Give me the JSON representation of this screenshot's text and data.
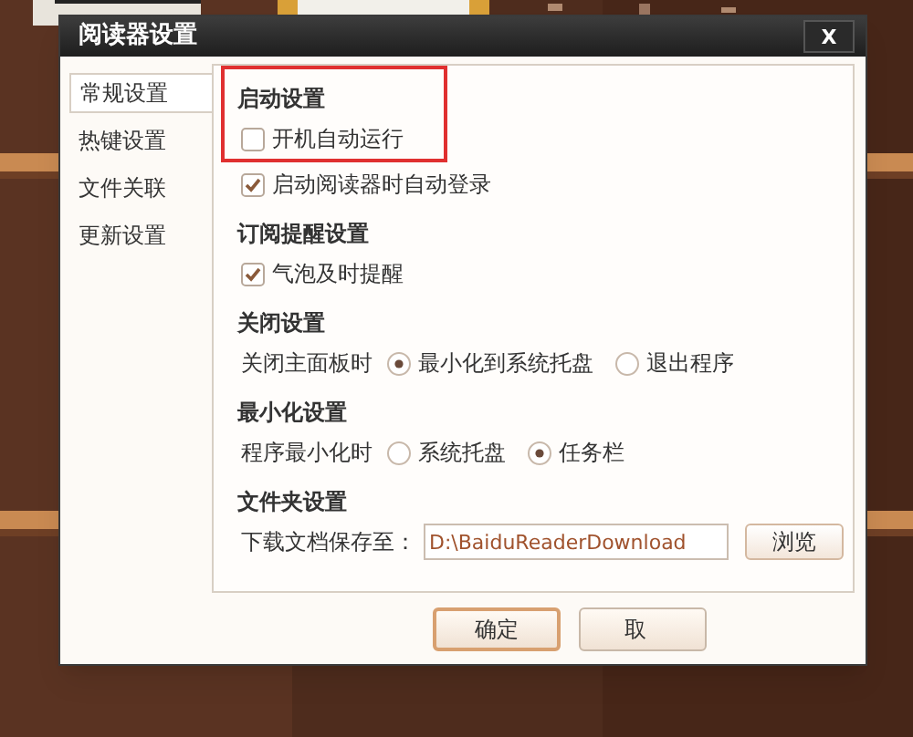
{
  "window": {
    "title": "阅读器设置",
    "close": "X"
  },
  "nav": [
    {
      "label": "常规设置",
      "selected": true
    },
    {
      "label": "热键设置",
      "selected": false
    },
    {
      "label": "文件关联",
      "selected": false
    },
    {
      "label": "更新设置",
      "selected": false
    }
  ],
  "sections": [
    {
      "title": "启动设置",
      "highlighted": true,
      "rows": [
        {
          "kind": "checkbox",
          "label": "开机自动运行",
          "checked": false
        },
        {
          "kind": "checkbox",
          "label": "启动阅读器时自动登录",
          "checked": true
        }
      ]
    },
    {
      "title": "订阅提醒设置",
      "rows": [
        {
          "kind": "checkbox",
          "label": "气泡及时提醒",
          "checked": true
        }
      ]
    },
    {
      "title": "关闭设置",
      "rows": [
        {
          "kind": "radio",
          "label": "关闭主面板时",
          "options": [
            {
              "label": "最小化到系统托盘",
              "selected": true
            },
            {
              "label": "退出程序",
              "selected": false
            }
          ]
        }
      ]
    },
    {
      "title": "最小化设置",
      "rows": [
        {
          "kind": "radio",
          "label": "程序最小化时",
          "options": [
            {
              "label": "系统托盘",
              "selected": false
            },
            {
              "label": "任务栏",
              "selected": true
            }
          ]
        }
      ]
    },
    {
      "title": "文件夹设置",
      "rows": [
        {
          "kind": "path",
          "label": "下载文档保存至：",
          "value": "D:\\BaiduReaderDownload",
          "button": "浏览"
        }
      ]
    }
  ],
  "buttons": [
    {
      "label": "确定",
      "default": true
    },
    {
      "label": "取",
      "default": false
    }
  ]
}
